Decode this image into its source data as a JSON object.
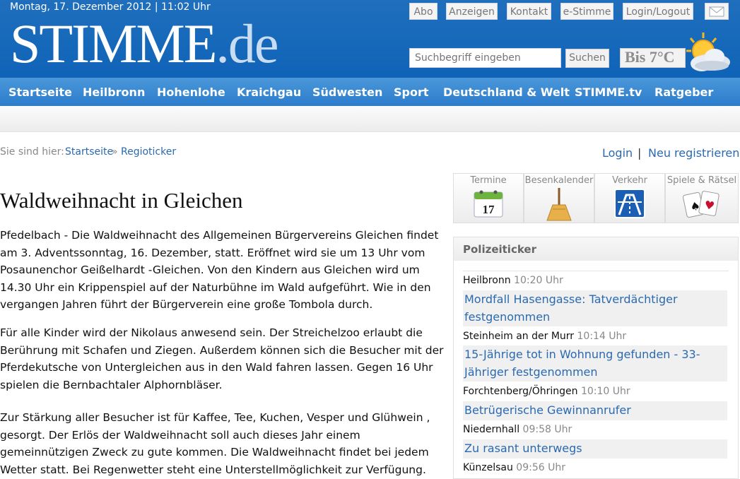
{
  "header": {
    "date": "Montag, 17. Dezember 2012 | 11:02 Uhr",
    "logo_main": "STIMME",
    "logo_tld": ".de",
    "top_links": [
      "Abo",
      "Anzeigen",
      "Kontakt",
      "e-Stimme",
      "Login/Logout"
    ],
    "mail_icon": "mail-icon",
    "search": {
      "placeholder": "Suchbegriff eingeben",
      "button": "Suchen"
    },
    "weather": {
      "text": "Bis 7°C",
      "icon": "sun-cloud-icon"
    }
  },
  "nav": {
    "items": [
      "Startseite",
      "Heilbronn",
      "Hohenlohe",
      "Kraichgau",
      "Südwesten",
      "Sport",
      "Deutschland & Welt",
      "STIMME.tv",
      "Ratgeber"
    ]
  },
  "breadcrumb": {
    "label": "Sie sind hier:",
    "items": [
      "Startseite",
      "Regioticker"
    ],
    "separator": "»"
  },
  "account": {
    "login": "Login",
    "separator": "|",
    "register": "Neu registrieren"
  },
  "article": {
    "title": "Waldweihnacht in Gleichen",
    "paragraphs": [
      "Pfedelbach - Die Waldweihnacht des Allgemeinen Bürgervereins Gleichen findet am 3. Adventssonntag, 16. Dezember, statt. Eröffnet wird sie um 13 Uhr vom Posaunenchor Geißelhardt -Gleichen. Von den Kindern aus Gleichen wird um 14.30 Uhr ein Krippenspiel auf der Naturbühne im Wald aufgeführt. Wie in den vergangen Jahren führt der Bürgerverein eine große Tombola durch.",
      "Für alle Kinder wird der Nikolaus anwesend sein. Der Streichelzoo erlaubt die Berührung mit Schafen und Ziegen. Außerdem können sich die Besucher mit der Pferdekutsche von Untergleichen aus in den Wald fahren lassen. Gegen 16 Uhr spielen die Bernbachtaler Alphornbläser.",
      "Zur Stärkung aller Besucher ist für Kaffee, Tee, Kuchen, Vesper und Glühwein , gesorgt. Der Erlös der Waldweihnacht soll auch dieses Jahr einem gemeinnützigen Zweck zu gute kommen. Die Waldweihnacht findet bei jedem Wetter statt. Bei Regenwetter steht eine Unterstellmöglichkeit zur Verfügung."
    ]
  },
  "tiles": [
    {
      "label": "Termine",
      "icon": "calendar-icon",
      "calendar_day": "17"
    },
    {
      "label": "Besenkalender",
      "icon": "broom-icon"
    },
    {
      "label": "Verkehr",
      "icon": "highway-sign-icon"
    },
    {
      "label": "Spiele & Rätsel",
      "icon": "playing-cards-icon"
    }
  ],
  "ticker": {
    "title": "Polizeiticker",
    "items": [
      {
        "place": "Heilbronn",
        "time": "10:20 Uhr",
        "headline": "Mordfall Hasengasse: Tatverdächtiger festgenommen"
      },
      {
        "place": "Steinheim an der Murr",
        "time": "10:14 Uhr",
        "headline": "15-Jährige tot in Wohnung gefunden - 33-Jähriger festgenommen"
      },
      {
        "place": "Forchtenberg/Öhringen",
        "time": "10:10 Uhr",
        "headline": "Betrügerische Gewinnanrufer"
      },
      {
        "place": "Niedernhall",
        "time": "09:58 Uhr",
        "headline": "Zu rasant unterwegs"
      },
      {
        "place": "Künzelsau",
        "time": "09:56 Uhr",
        "headline": ""
      }
    ]
  },
  "colors": {
    "brand_blue": "#0f63b7",
    "nav_blue": "#2c7ccc",
    "link_blue": "#2a6ab0"
  }
}
